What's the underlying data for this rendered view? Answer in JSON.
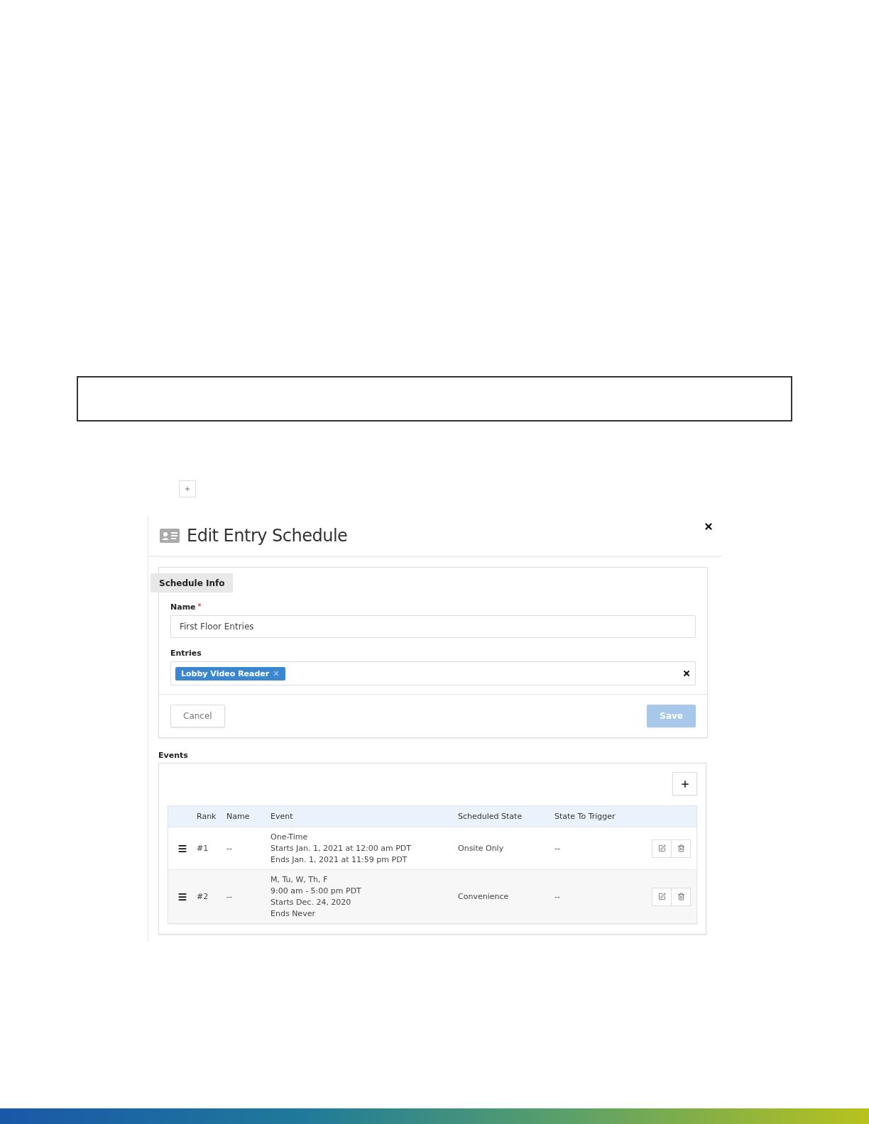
{
  "dialog": {
    "title": "Edit Entry Schedule",
    "section_tab": "Schedule Info",
    "name_field": {
      "label": "Name",
      "required_mark": "*",
      "value": "First Floor Entries"
    },
    "entries_field": {
      "label": "Entries",
      "tags": [
        "Lobby Video Reader"
      ]
    },
    "buttons": [
      {
        "label": "Cancel",
        "kind": "secondary",
        "disabled": false
      },
      {
        "label": "Save",
        "kind": "primary",
        "disabled": true
      }
    ],
    "events": {
      "label": "Events",
      "columns": [
        "Rank",
        "Name",
        "Event",
        "Scheduled State",
        "State To Trigger"
      ],
      "rows": [
        {
          "rank": "#1",
          "name": "--",
          "event": [
            "One-Time",
            "Starts Jan. 1, 2021 at 12:00 am PDT",
            "Ends Jan. 1, 2021 at 11:59 pm PDT"
          ],
          "scheduled_state": "Onsite Only",
          "state_to_trigger": "--"
        },
        {
          "rank": "#2",
          "name": "--",
          "event": [
            "M, Tu, W, Th, F",
            "9:00 am - 5:00 pm PDT",
            "Starts Dec. 24, 2020",
            "Ends Never"
          ],
          "scheduled_state": "Convenience",
          "state_to_trigger": "--"
        }
      ]
    }
  }
}
